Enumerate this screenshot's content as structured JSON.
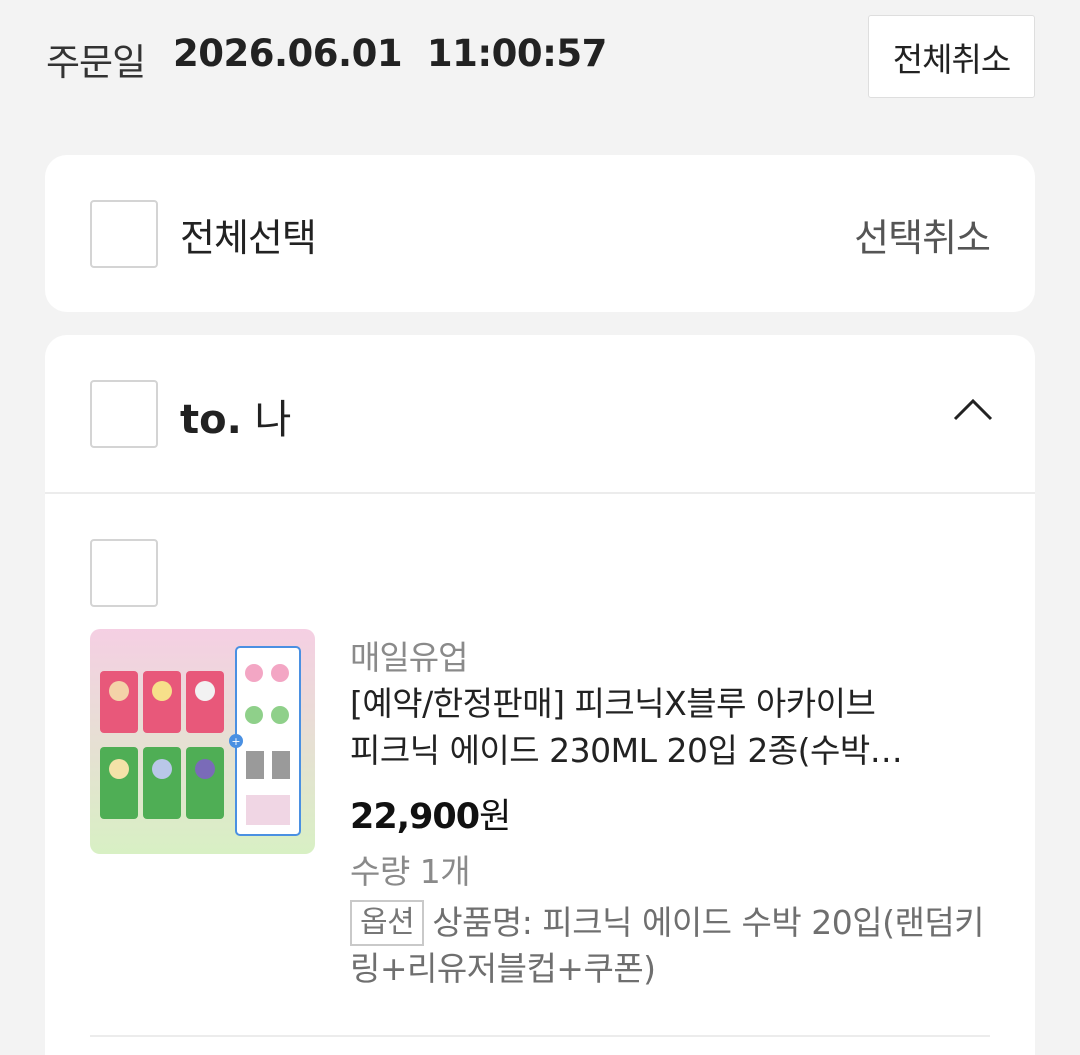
{
  "header": {
    "order_label": "주문일",
    "order_datetime": "2026.06.01  11:00:57",
    "cancel_all": "전체취소"
  },
  "select_bar": {
    "select_all": "전체선택",
    "cancel_selected": "선택취소"
  },
  "group": {
    "to_prefix": "to.",
    "recipient": "나"
  },
  "item": {
    "seller": "매일유업",
    "name_line1": "[예약/한정판매] 피크닉X블루 아카이브",
    "name_line2": "피크닉 에이드 230ML 20입 2종(수박…",
    "price": "22,900",
    "price_unit": "원",
    "quantity": "수량 1개",
    "option_badge": "옵션",
    "option_text": "상품명: 피크닉 에이드 수박 20입(랜덤키링+리유저블컵+쿠폰)"
  },
  "colors": {
    "background": "#f3f3f3",
    "card": "#ffffff",
    "muted_text": "#8a8a8a"
  }
}
